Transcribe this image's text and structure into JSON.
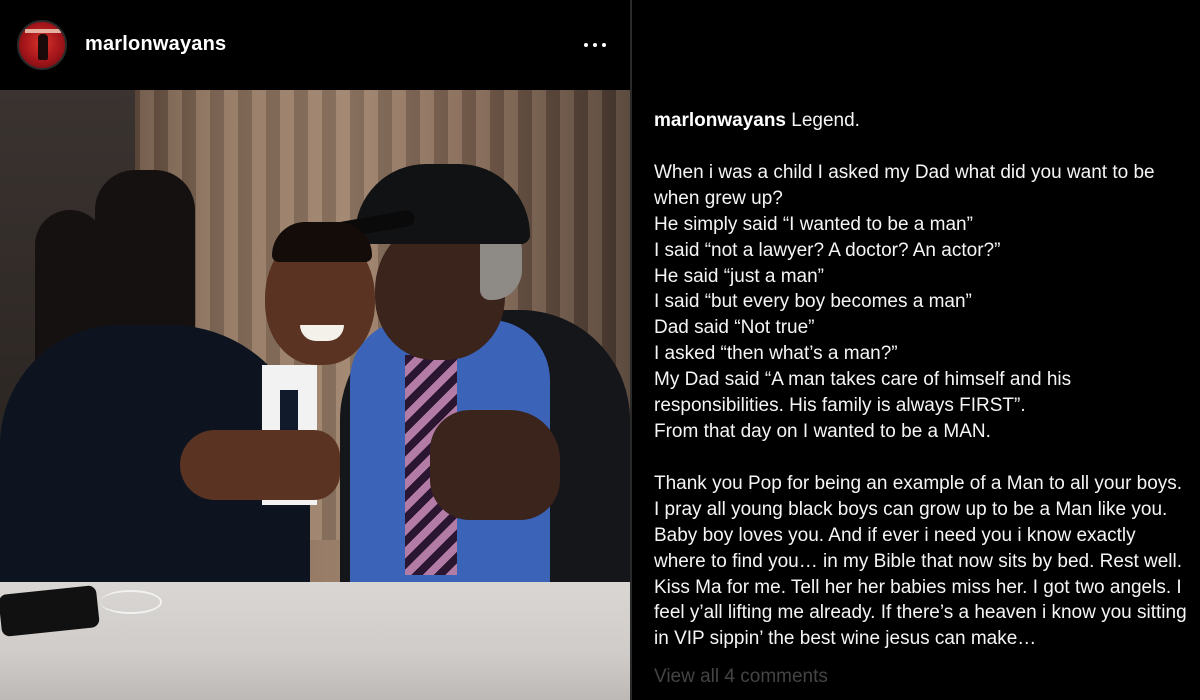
{
  "post": {
    "username": "marlonwayans",
    "more_label": "•••",
    "avatar": "profile-avatar"
  },
  "caption": {
    "username": "marlonwayans",
    "first_text": "Legend.",
    "paragraph1": [
      "When i was a child I asked my Dad what did you want to be when grew up?",
      "He simply said “I wanted to be a man”",
      "I said “not a lawyer? A doctor? An actor?”",
      "He said “just a man”",
      "I said “but every boy becomes a man”",
      "Dad said “Not true”",
      "I asked “then what’s a man?”",
      "My Dad said “A man takes care of himself and his responsibilities. His family is always FIRST”.",
      "From that day on I wanted to be a MAN."
    ],
    "paragraph2": "Thank you Pop for being an example of a Man to all your boys. I pray all young black boys can grow up to be a Man like you. Baby boy loves you. And if ever i need you i know exactly where to find you… in my Bible that now sits by bed. Rest well. Kiss Ma for me. Tell her her babies miss her. I got two angels. I feel y’all lifting me already. If there’s a heaven i know you sitting in VIP sippin’ the best wine jesus can make…"
  },
  "comments": {
    "view_all_label": "View all 4 comments"
  }
}
